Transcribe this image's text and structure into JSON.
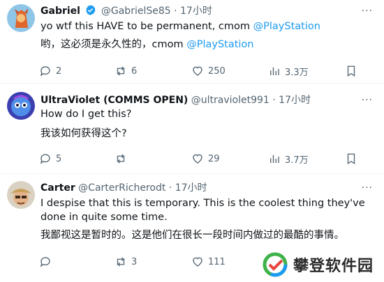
{
  "tweets": [
    {
      "name": "Gabriel",
      "handle": "@GabrielSe85",
      "sep": "·",
      "time": "17小时",
      "more": "···",
      "text_pre": "yo wtf this HAVE to be permanent, cmom ",
      "text_mention": "@PlayStation",
      "translation_pre": "哟，这必须是永久性的，cmom ",
      "translation_mention": "@PlayStation",
      "replies": "2",
      "retweets": "6",
      "likes": "250",
      "views": "3.3万"
    },
    {
      "name": "UltraViolet (COMMS OPEN)",
      "handle": "@ultraviolet991",
      "sep": "·",
      "time": "17小时",
      "more": "···",
      "text": "How do I get this?",
      "translation": "我该如何获得这个?",
      "replies": "5",
      "retweets": "",
      "likes": "29",
      "views": "3.7万"
    },
    {
      "name": "Carter",
      "handle": "@CarterRicherodt",
      "sep": "·",
      "time": "17小时",
      "more": "···",
      "text": "I despise that this is temporary. This is the coolest thing they've done in quite some time.",
      "translation": "我鄙视这是暂时的。这是他们在很长一段时间内做过的最酷的事情。",
      "replies": "",
      "retweets": "3",
      "likes": "111",
      "views": ""
    }
  ],
  "watermark": {
    "text": "攀登软件园"
  },
  "colors": {
    "link": "#1d9bf0",
    "muted": "#536471",
    "text": "#0f1419",
    "divider": "#eff3f4"
  }
}
